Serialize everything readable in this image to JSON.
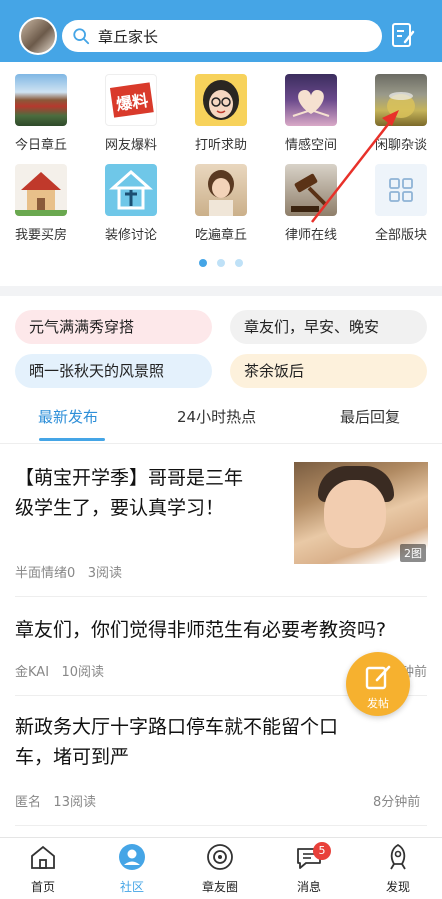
{
  "header": {
    "search_text": "章丘家长"
  },
  "forums": [
    {
      "label": "今日章丘",
      "icon": "city-photo"
    },
    {
      "label": "网友爆料",
      "icon": "baoliao-logo"
    },
    {
      "label": "打听求助",
      "icon": "question-girl"
    },
    {
      "label": "情感空间",
      "icon": "heart-book"
    },
    {
      "label": "闲聊杂谈",
      "icon": "tea-cup"
    },
    {
      "label": "我要买房",
      "icon": "house"
    },
    {
      "label": "装修讨论",
      "icon": "decoration-logo"
    },
    {
      "label": "吃遍章丘",
      "icon": "food-girl"
    },
    {
      "label": "律师在线",
      "icon": "gavel"
    },
    {
      "label": "全部版块",
      "icon": "grid-icon"
    }
  ],
  "chips": [
    {
      "label": "元气满满秀穿搭",
      "color": "#fde8ea"
    },
    {
      "label": "章友们，早安、晚安",
      "color": "#f1f1f1"
    },
    {
      "label": "晒一张秋天的风景照",
      "color": "#e4f1fc"
    },
    {
      "label": "茶余饭后",
      "color": "#fdf1dc"
    }
  ],
  "tabs": [
    {
      "label": "最新发布",
      "active": true
    },
    {
      "label": "24小时热点",
      "active": false
    },
    {
      "label": "最后回复",
      "active": false
    }
  ],
  "posts": [
    {
      "title_line1": "【萌宝开学季】哥哥是三年",
      "title_line2": "级学生了，要认真学习！",
      "author": "半面情绪0",
      "reads": "3阅读",
      "image_badge": "2图"
    },
    {
      "title_line1": "章友们，你们觉得非师范生有必要考教资吗?",
      "author": "金KAI",
      "reads": "10阅读",
      "time": "钟前"
    },
    {
      "title_line1": "新政务大厅十字路口停车就不能留个口",
      "title_line2": "车，堵可到严",
      "author": "匿名",
      "reads": "13阅读",
      "time": "8分钟前"
    }
  ],
  "fab": {
    "label": "发帖"
  },
  "bottom_nav": [
    {
      "label": "首页",
      "icon": "home-icon",
      "active": false
    },
    {
      "label": "社区",
      "icon": "community-icon",
      "active": true
    },
    {
      "label": "章友圈",
      "icon": "camera-circle-icon",
      "active": false
    },
    {
      "label": "消息",
      "icon": "message-icon",
      "active": false,
      "badge": "5"
    },
    {
      "label": "发现",
      "icon": "rocket-icon",
      "active": false
    }
  ],
  "colors": {
    "brand": "#45a5e6",
    "fab": "#f6b12f",
    "badge": "#e8403a"
  }
}
